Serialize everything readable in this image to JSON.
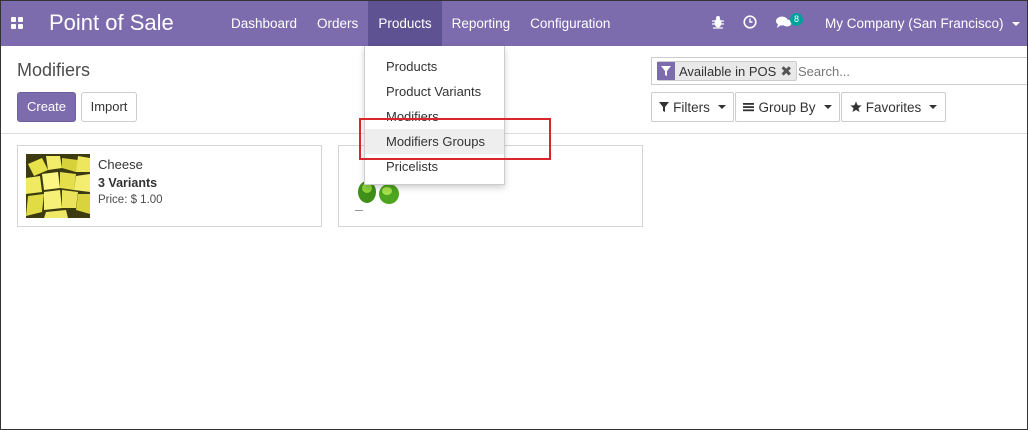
{
  "navbar": {
    "app_title": "Point of Sale",
    "menu": [
      "Dashboard",
      "Orders",
      "Products",
      "Reporting",
      "Configuration"
    ],
    "active_menu": "Products",
    "chat_badge": "8",
    "company": "My Company (San Francisco)",
    "color": "#7c6bad"
  },
  "control_panel": {
    "title": "Modifiers",
    "create_label": "Create",
    "import_label": "Import",
    "search": {
      "facet_label": "Available in POS",
      "placeholder": "Search..."
    },
    "filters_label": "Filters",
    "group_by_label": "Group By",
    "favorites_label": "Favorites"
  },
  "products_dropdown": {
    "items": [
      "Products",
      "Product Variants",
      "Modifiers",
      "Modifiers Groups",
      "Pricelists"
    ],
    "highlighted": "Modifiers Groups"
  },
  "kanban": {
    "cards": [
      {
        "name": "Cheese",
        "variants": "3 Variants",
        "price": "Price: $ 1.00"
      },
      {
        "name": "",
        "variants": "",
        "price": ""
      }
    ]
  },
  "colors": {
    "accent": "#7c6bad",
    "annotation": "#d9262c",
    "badge": "#00a09d"
  }
}
